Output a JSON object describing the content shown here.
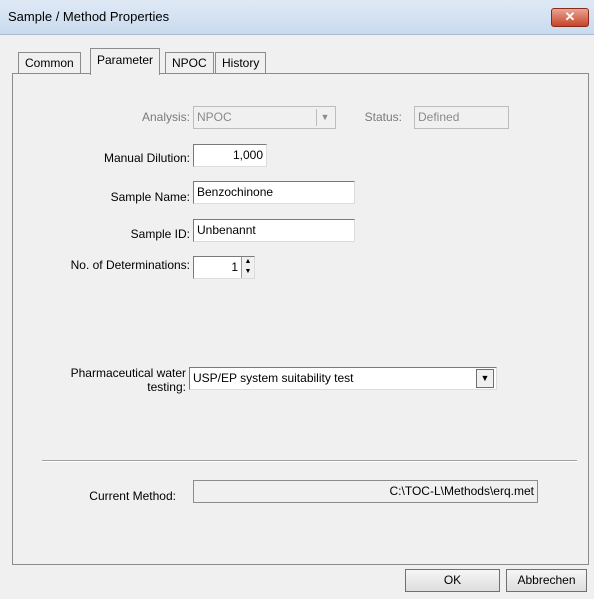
{
  "window": {
    "title": "Sample / Method Properties",
    "close_glyph": "✕"
  },
  "tabs": [
    {
      "label": "Common"
    },
    {
      "label": "Parameter"
    },
    {
      "label": "NPOC"
    },
    {
      "label": "History"
    }
  ],
  "form": {
    "analysis": {
      "label": "Analysis:",
      "value": "NPOC"
    },
    "status": {
      "label": "Status:",
      "value": "Defined"
    },
    "manual_dilution": {
      "label": "Manual Dilution:",
      "value": "1,000"
    },
    "sample_name": {
      "label": "Sample Name:",
      "value": "Benzochinone"
    },
    "sample_id": {
      "label": "Sample ID:",
      "value": "Unbenannt"
    },
    "determinations": {
      "label": "No. of Determinations:",
      "value": "1"
    },
    "pharma": {
      "label_line1": "Pharmaceutical water",
      "label_line2": "testing:",
      "value": "USP/EP system suitability test"
    },
    "current_method": {
      "label": "Current Method:",
      "value": "C:\\TOC-L\\Methods\\erq.met"
    }
  },
  "buttons": {
    "ok": "OK",
    "cancel": "Abbrechen"
  }
}
